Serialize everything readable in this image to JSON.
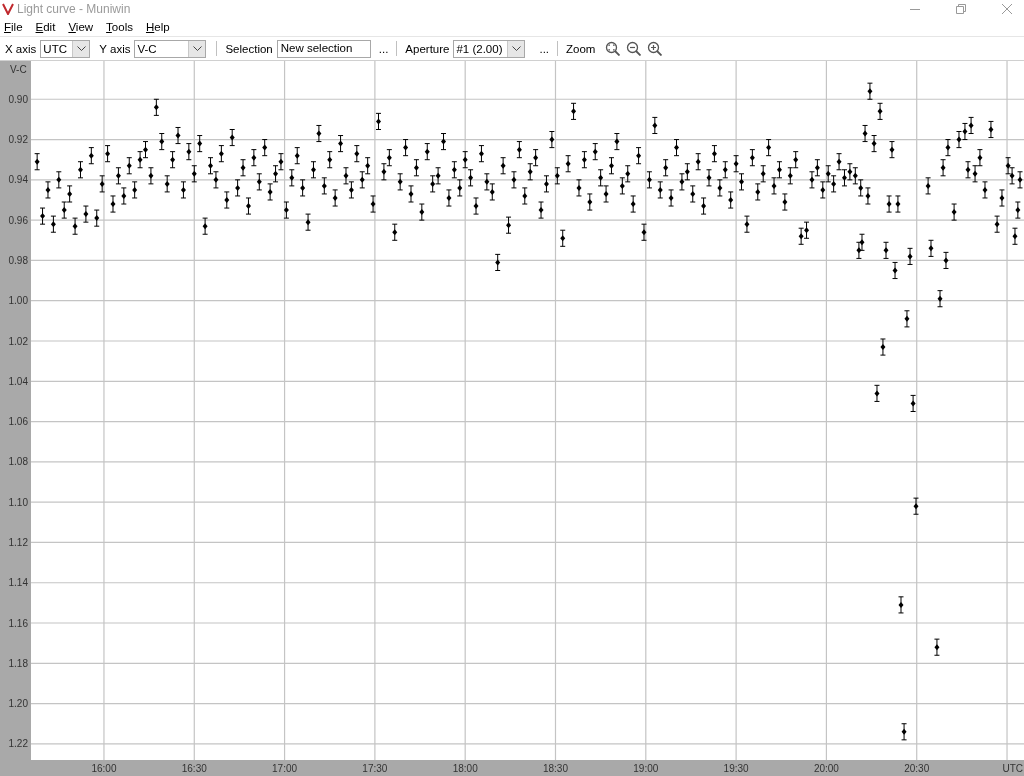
{
  "window": {
    "title": "Light curve - Muniwin"
  },
  "menu": [
    {
      "label": "File",
      "mnemonic": true
    },
    {
      "label": "Edit",
      "mnemonic": true
    },
    {
      "label": "View",
      "mnemonic": true
    },
    {
      "label": "Tools",
      "mnemonic": true
    },
    {
      "label": "Help",
      "mnemonic": true
    }
  ],
  "toolbar": {
    "x_axis": {
      "label": "X axis",
      "value": "UTC"
    },
    "y_axis": {
      "label": "Y axis",
      "value": "V-C"
    },
    "selection": {
      "label": "Selection",
      "value": "New selection",
      "button": "..."
    },
    "aperture": {
      "label": "Aperture",
      "value": "#1 (2.00)",
      "button": "..."
    },
    "zoom": {
      "label": "Zoom"
    }
  },
  "graph": {
    "chart_data": {
      "type": "scatter",
      "xlabel": "UTC",
      "ylabel": "V-C",
      "xlim": [
        15.596,
        21.094
      ],
      "ylim": [
        1.228,
        0.881
      ],
      "xticks": [
        {
          "value": 16,
          "label": "16:00"
        },
        {
          "value": 16.5,
          "label": "16:30"
        },
        {
          "value": 17,
          "label": "17:00"
        },
        {
          "value": 17.5,
          "label": "17:30"
        },
        {
          "value": 18,
          "label": "18:00"
        },
        {
          "value": 18.5,
          "label": "18:30"
        },
        {
          "value": 19,
          "label": "19:00"
        },
        {
          "value": 19.5,
          "label": "19:30"
        },
        {
          "value": 20,
          "label": "20:00"
        },
        {
          "value": 20.5,
          "label": "20:30"
        }
      ],
      "yticks": [
        {
          "value": 0.9,
          "label": "0.90"
        },
        {
          "value": 0.92,
          "label": "0.92"
        },
        {
          "value": 0.94,
          "label": "0.94"
        },
        {
          "value": 0.96,
          "label": "0.96"
        },
        {
          "value": 0.98,
          "label": "0.98"
        },
        {
          "value": 1.0,
          "label": "1.00"
        },
        {
          "value": 1.02,
          "label": "1.02"
        },
        {
          "value": 1.04,
          "label": "1.04"
        },
        {
          "value": 1.06,
          "label": "1.06"
        },
        {
          "value": 1.08,
          "label": "1.08"
        },
        {
          "value": 1.1,
          "label": "1.10"
        },
        {
          "value": 1.12,
          "label": "1.12"
        },
        {
          "value": 1.14,
          "label": "1.14"
        },
        {
          "value": 1.16,
          "label": "1.16"
        },
        {
          "value": 1.18,
          "label": "1.18"
        },
        {
          "value": 1.2,
          "label": "1.20"
        },
        {
          "value": 1.22,
          "label": "1.22"
        }
      ],
      "x": [
        15.63,
        15.66,
        15.69,
        15.72,
        15.75,
        15.78,
        15.81,
        15.84,
        15.87,
        15.9,
        15.93,
        15.96,
        15.99,
        16.02,
        16.05,
        16.08,
        16.11,
        16.14,
        16.17,
        16.2,
        16.23,
        16.26,
        16.29,
        16.32,
        16.35,
        16.38,
        16.41,
        16.44,
        16.47,
        16.5,
        16.53,
        16.56,
        16.59,
        16.62,
        16.65,
        16.68,
        16.71,
        16.74,
        16.77,
        16.8,
        16.83,
        16.86,
        16.89,
        16.92,
        16.95,
        16.98,
        17.01,
        17.04,
        17.07,
        17.1,
        17.13,
        17.16,
        17.19,
        17.22,
        17.25,
        17.28,
        17.31,
        17.34,
        17.37,
        17.4,
        17.43,
        17.46,
        17.49,
        17.52,
        17.55,
        17.58,
        17.61,
        17.64,
        17.67,
        17.7,
        17.73,
        17.76,
        17.79,
        17.82,
        17.85,
        17.88,
        17.91,
        17.94,
        17.97,
        18.0,
        18.03,
        18.06,
        18.09,
        18.12,
        18.15,
        18.18,
        18.21,
        18.24,
        18.27,
        18.3,
        18.33,
        18.36,
        18.39,
        18.42,
        18.45,
        18.48,
        18.51,
        18.54,
        18.57,
        18.6,
        18.63,
        18.66,
        18.69,
        18.72,
        18.75,
        18.78,
        18.81,
        18.84,
        18.87,
        18.9,
        18.93,
        18.96,
        18.99,
        19.02,
        19.05,
        19.08,
        19.11,
        19.14,
        19.17,
        19.2,
        19.23,
        19.26,
        19.29,
        19.32,
        19.35,
        19.38,
        19.41,
        19.44,
        19.47,
        19.5,
        19.53,
        19.56,
        19.59,
        19.62,
        19.65,
        19.68,
        19.71,
        19.74,
        19.77,
        19.8,
        19.83,
        19.86,
        19.89,
        19.92,
        19.95,
        19.98,
        20.01,
        20.04,
        20.07,
        20.1,
        20.13,
        20.16,
        20.18,
        20.19,
        20.197,
        20.214,
        20.23,
        20.241,
        20.264,
        20.28,
        20.297,
        20.313,
        20.33,
        20.347,
        20.363,
        20.38,
        20.396,
        20.413,
        20.43,
        20.446,
        20.463,
        20.48,
        20.496,
        20.563,
        20.579,
        20.612,
        20.629,
        20.646,
        20.662,
        20.673,
        20.707,
        20.734,
        20.767,
        20.784,
        20.801,
        20.823,
        20.85,
        20.878,
        20.911,
        20.945,
        20.972,
        21.006,
        21.028,
        21.044,
        21.06,
        21.072
      ],
      "grid": true,
      "series": [
        {
          "color": "#000000",
          "errors": [
            0.004,
            0.004,
            0.004,
            0.004,
            0.004,
            0.004,
            0.004,
            0.004,
            0.004,
            0.004,
            0.004,
            0.004,
            0.004,
            0.004,
            0.004,
            0.004,
            0.004,
            0.004,
            0.004,
            0.004,
            0.004,
            0.004,
            0.004,
            0.004,
            0.004,
            0.004,
            0.004,
            0.004,
            0.004,
            0.004,
            0.004,
            0.004,
            0.004,
            0.004,
            0.004,
            0.004,
            0.004,
            0.004,
            0.004,
            0.004,
            0.004,
            0.004,
            0.004,
            0.004,
            0.004,
            0.004,
            0.004,
            0.004,
            0.004,
            0.004,
            0.004,
            0.004,
            0.004,
            0.004,
            0.004,
            0.004,
            0.004,
            0.004,
            0.004,
            0.004,
            0.004,
            0.004,
            0.004,
            0.004,
            0.004,
            0.004,
            0.004,
            0.004,
            0.004,
            0.004,
            0.004,
            0.004,
            0.004,
            0.004,
            0.004,
            0.004,
            0.004,
            0.004,
            0.004,
            0.004,
            0.004,
            0.004,
            0.004,
            0.004,
            0.004,
            0.004,
            0.004,
            0.004,
            0.004,
            0.004,
            0.004,
            0.004,
            0.004,
            0.004,
            0.004,
            0.004,
            0.004,
            0.004,
            0.004,
            0.004,
            0.004,
            0.004,
            0.004,
            0.004,
            0.004,
            0.004,
            0.004,
            0.004,
            0.004,
            0.004,
            0.004,
            0.004,
            0.004,
            0.004,
            0.004,
            0.004,
            0.004,
            0.004,
            0.004,
            0.004,
            0.004,
            0.004,
            0.004,
            0.004,
            0.004,
            0.004,
            0.004,
            0.004,
            0.004,
            0.004,
            0.004,
            0.004,
            0.004,
            0.004,
            0.004,
            0.004,
            0.004,
            0.004,
            0.004,
            0.004,
            0.004,
            0.004,
            0.004,
            0.004,
            0.004,
            0.004,
            0.004,
            0.004,
            0.004,
            0.004,
            0.004,
            0.004,
            0.004,
            0.004,
            0.004,
            0.004,
            0.004,
            0.004,
            0.004,
            0.004,
            0.004,
            0.004,
            0.004,
            0.004,
            0.004,
            0.004,
            0.004,
            0.004,
            0.004,
            0.004,
            0.004,
            0.004,
            0.004,
            0.004,
            0.004,
            0.004,
            0.004,
            0.004,
            0.004,
            0.004,
            0.004,
            0.004,
            0.004,
            0.004,
            0.004,
            0.004,
            0.004,
            0.004,
            0.004,
            0.004,
            0.004,
            0.004,
            0.004,
            0.004,
            0.004,
            0.004
          ],
          "values": [
            0.931,
            0.958,
            0.945,
            0.962,
            0.94,
            0.955,
            0.947,
            0.963,
            0.935,
            0.957,
            0.928,
            0.959,
            0.942,
            0.927,
            0.952,
            0.938,
            0.948,
            0.933,
            0.945,
            0.93,
            0.925,
            0.938,
            0.904,
            0.921,
            0.942,
            0.93,
            0.918,
            0.945,
            0.926,
            0.937,
            0.922,
            0.963,
            0.933,
            0.94,
            0.927,
            0.95,
            0.919,
            0.944,
            0.934,
            0.953,
            0.929,
            0.941,
            0.924,
            0.946,
            0.937,
            0.931,
            0.955,
            0.939,
            0.928,
            0.944,
            0.961,
            0.935,
            0.917,
            0.943,
            0.93,
            0.949,
            0.922,
            0.938,
            0.945,
            0.927,
            0.94,
            0.933,
            0.952,
            0.911,
            0.936,
            0.929,
            0.966,
            0.941,
            0.924,
            0.947,
            0.934,
            0.956,
            0.926,
            0.942,
            0.938,
            0.921,
            0.949,
            0.935,
            0.944,
            0.93,
            0.939,
            0.953,
            0.927,
            0.941,
            0.946,
            0.981,
            0.933,
            0.9625,
            0.94,
            0.925,
            0.948,
            0.936,
            0.929,
            0.955,
            0.942,
            0.92,
            0.938,
            0.969,
            0.932,
            0.906,
            0.944,
            0.93,
            0.951,
            0.926,
            0.939,
            0.947,
            0.933,
            0.921,
            0.943,
            0.937,
            0.952,
            0.928,
            0.966,
            0.94,
            0.913,
            0.945,
            0.934,
            0.949,
            0.924,
            0.941,
            0.936,
            0.947,
            0.931,
            0.953,
            0.939,
            0.927,
            0.944,
            0.935,
            0.95,
            0.932,
            0.941,
            0.962,
            0.929,
            0.946,
            0.937,
            0.924,
            0.943,
            0.935,
            0.951,
            0.938,
            0.93,
            0.968,
            0.965,
            0.94,
            0.934,
            0.945,
            0.937,
            0.942,
            0.931,
            0.939,
            0.936,
            0.938,
            0.975,
            0.944,
            0.971,
            0.917,
            0.948,
            0.896,
            0.922,
            1.046,
            0.906,
            1.023,
            0.975,
            0.952,
            0.925,
            0.985,
            0.952,
            1.151,
            1.214,
            1.009,
            0.978,
            1.051,
            1.102,
            0.943,
            0.974,
            1.172,
            0.999,
            0.934,
            0.98,
            0.924,
            0.956,
            0.92,
            0.916,
            0.935,
            0.913,
            0.937,
            0.929,
            0.945,
            0.915,
            0.962,
            0.949,
            0.933,
            0.938,
            0.968,
            0.955,
            0.94
          ]
        }
      ]
    }
  }
}
